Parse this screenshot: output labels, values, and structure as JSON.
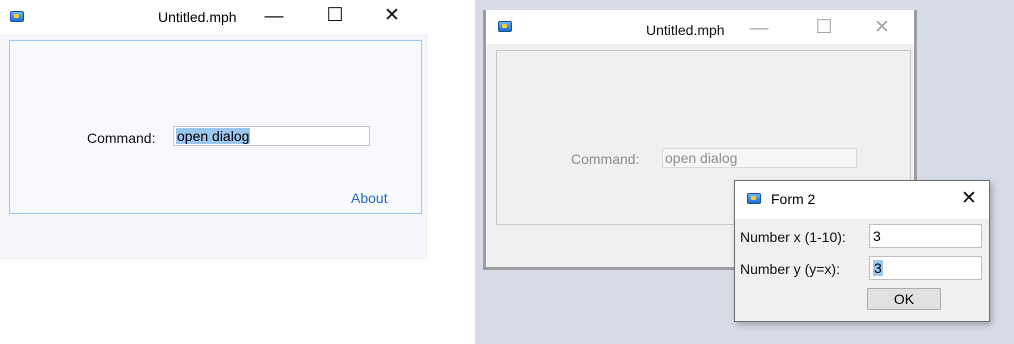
{
  "window1": {
    "title": "Untitled.mph",
    "command_label": "Command:",
    "command_value": "open dialog",
    "about_link": "About"
  },
  "window2": {
    "title": "Untitled.mph",
    "command_label": "Command:",
    "command_value": "open dialog"
  },
  "form2": {
    "title": "Form 2",
    "x_label": "Number x (1-10):",
    "x_value": "3",
    "y_label": "Number y (y=x):",
    "y_value": "3",
    "ok_label": "OK"
  },
  "icons": {
    "minimize": "—",
    "maximize": "☐",
    "close": "✕",
    "app_icon": "application-icon"
  },
  "colors": {
    "selection": "#9bc6ee",
    "link": "#2468c9",
    "active_panel_border": "#9cc7ee"
  }
}
